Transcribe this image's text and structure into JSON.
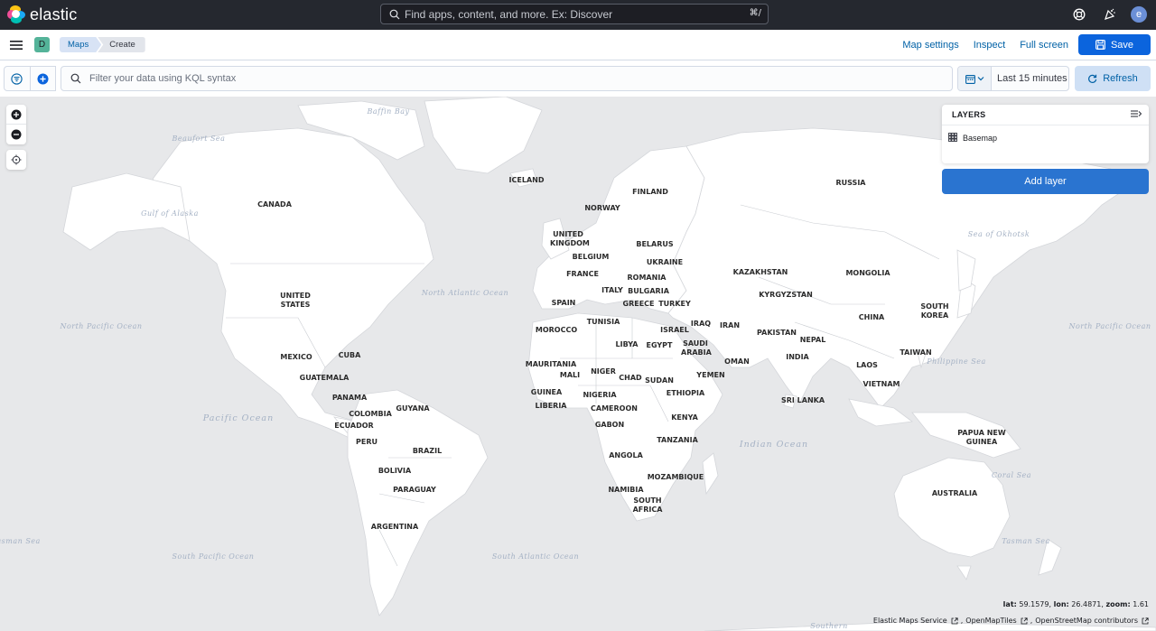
{
  "header": {
    "brand": "elastic",
    "search_placeholder": "Find apps, content, and more. Ex: Discover",
    "search_shortcut": "⌘/",
    "avatar_initial": "e",
    "colors": {
      "bg": "#25282f",
      "accent": "#0b64dd"
    }
  },
  "subheader": {
    "space_initial": "D",
    "breadcrumbs": [
      "Maps",
      "Create"
    ],
    "links": {
      "settings": "Map settings",
      "inspect": "Inspect",
      "fullscreen": "Full screen"
    },
    "save_label": "Save"
  },
  "query": {
    "placeholder": "Filter your data using KQL syntax",
    "time_range": "Last 15 minutes",
    "refresh_label": "Refresh"
  },
  "layers": {
    "title": "LAYERS",
    "items": [
      {
        "name": "Basemap",
        "icon": "grid-icon"
      }
    ],
    "add_label": "Add layer"
  },
  "map": {
    "countries": [
      "CANADA",
      "ICELAND",
      "FINLAND",
      "NORWAY",
      "RUSSIA",
      "UNITED KINGDOM",
      "BELARUS",
      "BELGIUM",
      "UKRAINE",
      "FRANCE",
      "ROMANIA",
      "KAZAKHSTAN",
      "MONGOLIA",
      "ITALY",
      "BULGARIA",
      "UNITED STATES",
      "SPAIN",
      "GREECE",
      "TURKEY",
      "KYRGYZSTAN",
      "SOUTH KOREA",
      "CHINA",
      "TUNISIA",
      "IRAQ",
      "IRAN",
      "MOROCCO",
      "ISRAEL",
      "PAKISTAN",
      "NEPAL",
      "LIBYA",
      "EGYPT",
      "SAUDI ARABIA",
      "MEXICO",
      "CUBA",
      "TAIWAN",
      "INDIA",
      "OMAN",
      "MAURITANIA",
      "MALI",
      "NIGER",
      "LAOS",
      "YEMEN",
      "GUATEMALA",
      "CHAD",
      "SUDAN",
      "VIETNAM",
      "GUINEA",
      "ETHIOPIA",
      "NIGERIA",
      "PANAMA",
      "SRI LANKA",
      "LIBERIA",
      "GUYANA",
      "CAMEROON",
      "COLOMBIA",
      "KENYA",
      "ECUADOR",
      "GABON",
      "PAPUA NEW GUINEA",
      "PERU",
      "TANZANIA",
      "BRAZIL",
      "ANGOLA",
      "BOLIVIA",
      "MOZAMBIQUE",
      "PARAGUAY",
      "NAMIBIA",
      "AUSTRALIA",
      "SOUTH AFRICA",
      "ARGENTINA"
    ],
    "seas": [
      "Baffin Bay",
      "Beaufort Sea",
      "Gulf of Alaska",
      "Sea of Okhotsk",
      "North Atlantic Ocean",
      "North Pacific Ocean",
      "Philippine Sea",
      "Pacific Ocean",
      "Indian Ocean",
      "Coral Sea",
      "Tasman Sea",
      "South Pacific Ocean",
      "South Atlantic Ocean",
      "Southern"
    ],
    "coords": {
      "lat": "59.1579",
      "lon": "26.4871",
      "zoom": "1.61"
    },
    "coord_labels": {
      "lat": "lat:",
      "lon": "lon:",
      "zoom": "zoom:"
    },
    "attribution": [
      "Elastic Maps Service",
      "OpenMapTiles",
      "OpenStreetMap contributors"
    ]
  }
}
